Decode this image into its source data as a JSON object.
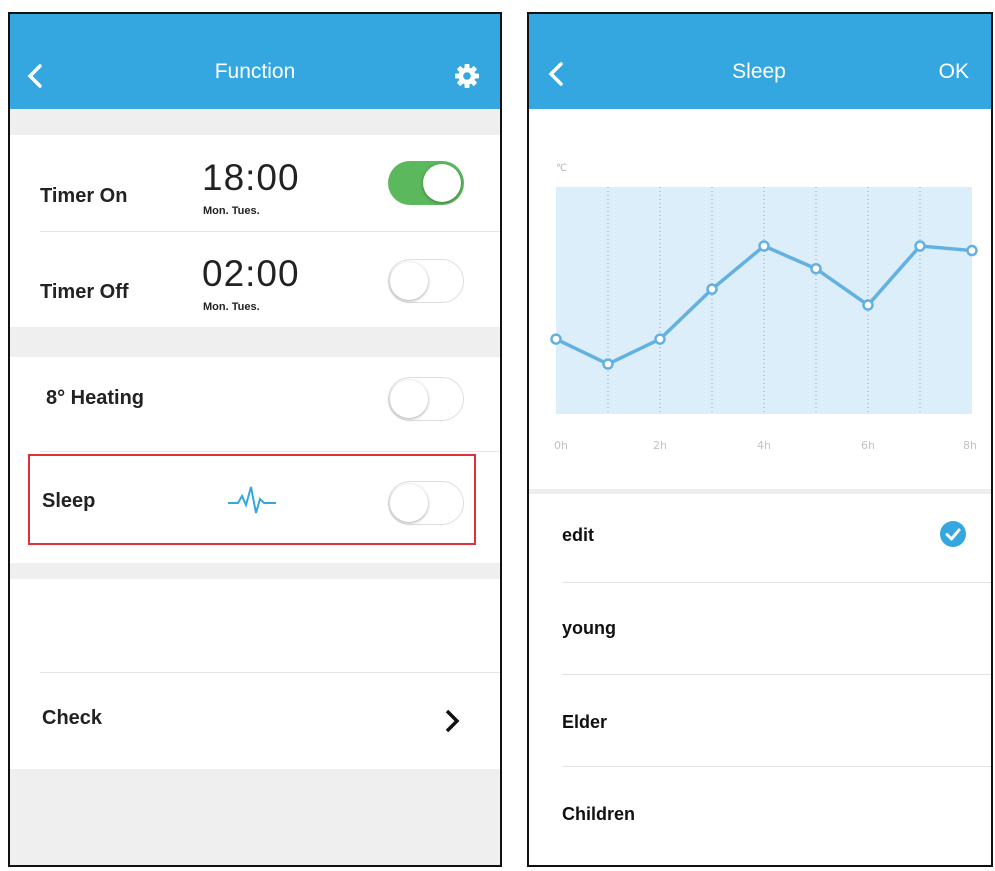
{
  "function_screen": {
    "title": "Function",
    "rows": {
      "timer_on": {
        "label": "Timer On",
        "time": "18:00",
        "days": "Mon. Tues.",
        "enabled": true
      },
      "timer_off": {
        "label": "Timer Off",
        "time": "02:00",
        "days": "Mon. Tues.",
        "enabled": false
      },
      "heating": {
        "label": "8° Heating",
        "enabled": false
      },
      "sleep": {
        "label": "Sleep",
        "enabled": false
      },
      "check": {
        "label": "Check"
      }
    },
    "colors": {
      "nav": "#34a7e0",
      "toggle_on": "#5cb85c",
      "highlight": "#e0313a"
    }
  },
  "sleep_screen": {
    "title": "Sleep",
    "ok_label": "OK",
    "unit": "℃",
    "modes": [
      {
        "label": "edit",
        "selected": true
      },
      {
        "label": "young",
        "selected": false
      },
      {
        "label": "Elder",
        "selected": false
      },
      {
        "label": "Children",
        "selected": false
      }
    ]
  },
  "chart_data": {
    "type": "line",
    "x_ticks": [
      "0h",
      "2h",
      "4h",
      "6h",
      "8h"
    ],
    "x": [
      0,
      1,
      2,
      3,
      4,
      5,
      6,
      7,
      8
    ],
    "y": [
      3.3,
      2.2,
      3.3,
      5.5,
      7.4,
      6.4,
      4.8,
      7.4,
      7.2
    ],
    "ylabel": "℃",
    "ylim": [
      0,
      10
    ],
    "grid": "vertical dotted",
    "colors": {
      "line": "#62b1e2",
      "fill": "#dbeef9"
    }
  }
}
